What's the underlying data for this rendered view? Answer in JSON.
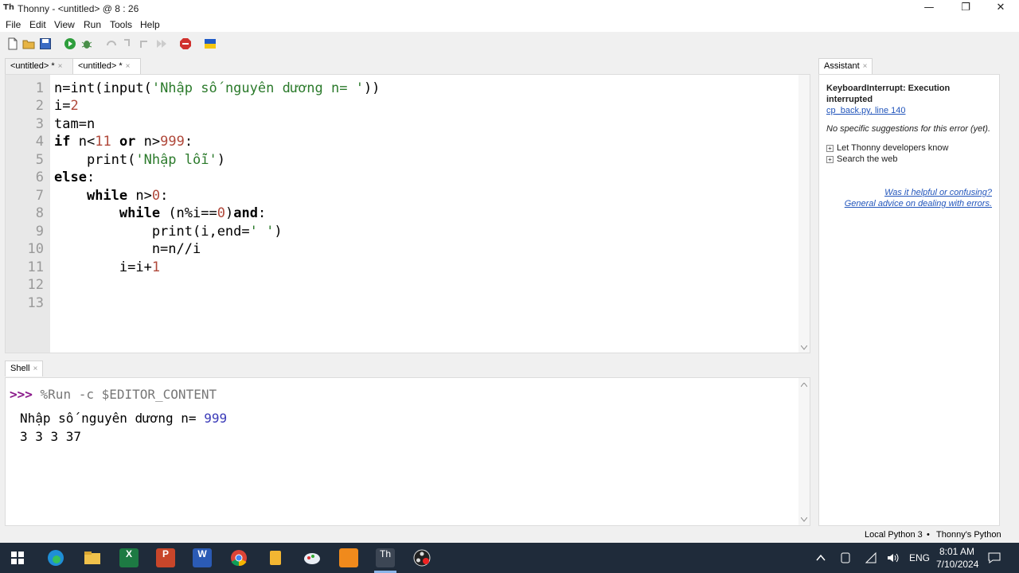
{
  "window": {
    "title": "Thonny  -  <untitled>  @  8 : 26",
    "minimize": "—",
    "restore": "❐",
    "close": "✕"
  },
  "menu": [
    "File",
    "Edit",
    "View",
    "Run",
    "Tools",
    "Help"
  ],
  "editor_tabs": [
    {
      "label": "<untitled> *",
      "close": "×"
    },
    {
      "label": "<untitled> *",
      "close": "×"
    }
  ],
  "editor": {
    "line_numbers": [
      "1",
      "2",
      "3",
      "4",
      "5",
      "6",
      "7",
      "8",
      "9",
      "10",
      "11",
      "12",
      "13"
    ],
    "lines": [
      "n=int(input('Nhập số nguyên dương n= '))",
      "i=2",
      "tam=n",
      "if n<11 or n>999:",
      "    print('Nhập lỗi')",
      "else:",
      "    while n>0:",
      "        while (n%i==0)and:",
      "            print(i,end=' ')",
      "            n=n//i",
      "        i=i+1",
      "",
      ""
    ]
  },
  "shell": {
    "tab_label": "Shell",
    "tab_close": "×",
    "prompt": ">>>",
    "command": " %Run -c $EDITOR_CONTENT",
    "output_prompt": "Nhập số nguyên dương n= ",
    "output_input": "999",
    "output_result": "3 3 3 37"
  },
  "assistant": {
    "tab_label": "Assistant",
    "tab_close": "×",
    "error_title": "KeyboardInterrupt: Execution interrupted",
    "error_location": "cp_back.py, line 140",
    "no_suggestions": "No specific suggestions for this error (yet).",
    "option1": "Let Thonny developers know",
    "option2": "Search the web",
    "feedback_link": "Was it helpful or confusing?",
    "advice_link": "General advice on dealing with errors."
  },
  "statusbar": {
    "interpreter": "Local Python 3",
    "separator": "•",
    "python_name": "Thonny's Python"
  },
  "taskbar": {
    "apps": [
      {
        "icon": "windows-start-icon"
      },
      {
        "icon": "edge-icon"
      },
      {
        "icon": "file-explorer-icon"
      },
      {
        "icon": "excel-icon",
        "glyph": "X"
      },
      {
        "icon": "powerpoint-icon",
        "glyph": "P"
      },
      {
        "icon": "word-icon",
        "glyph": "W"
      },
      {
        "icon": "chrome-icon"
      },
      {
        "icon": "notes-icon"
      },
      {
        "icon": "paint-icon"
      },
      {
        "icon": "orange-app-icon"
      },
      {
        "icon": "thonny-icon",
        "glyph": "Th"
      },
      {
        "icon": "obs-icon"
      }
    ],
    "language": "ENG",
    "time": "8:01 AM",
    "date": "7/10/2024"
  },
  "colors": {
    "keyword": "#000000",
    "string": "#2b7a2b",
    "number": "#b0483a",
    "link": "#2255bb",
    "taskbar": "#1f2b3a"
  }
}
